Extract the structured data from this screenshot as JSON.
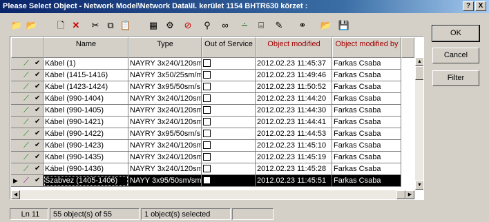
{
  "window": {
    "title": "Please Select Object - Network Model\\Network Data\\II. kerület 1154 BHTR630 körzet :",
    "help_label": "?",
    "close_label": "X"
  },
  "toolbar": {
    "tools": [
      "up-folder-icon",
      "folder-up-icon",
      "new-icon",
      "delete-icon",
      "cut-icon",
      "copy-icon",
      "paste-icon",
      "properties-icon",
      "tools-icon",
      "forbidden-icon",
      "search-settings-icon",
      "view-icon",
      "filter-icon",
      "tree-icon",
      "edit-icon",
      "binoculars-icon",
      "open-folder-icon",
      "save-icon"
    ]
  },
  "grid": {
    "columns": [
      "Name",
      "Type",
      "Out of Service",
      "Object modified",
      "Object modified by"
    ],
    "rows": [
      {
        "name": "Kábel (1)",
        "type": "NAYRY 3x240/120sm",
        "modified": "2012.02.23 11:45:37",
        "by": "Farkas Csaba"
      },
      {
        "name": "Kábel (1415-1416)",
        "type": "NAYRY 3x50/25sm/m",
        "modified": "2012.02.23 11:49:46",
        "by": "Farkas Csaba"
      },
      {
        "name": "Kábel (1423-1424)",
        "type": "NAYRY 3x95/50sm/s",
        "modified": "2012.02.23 11:50:52",
        "by": "Farkas Csaba"
      },
      {
        "name": "Kábel (990-1404)",
        "type": "NAYRY 3x240/120sm",
        "modified": "2012.02.23 11:44:20",
        "by": "Farkas Csaba"
      },
      {
        "name": "Kábel (990-1405)",
        "type": "NAYRY 3x240/120sm",
        "modified": "2012.02.23 11:44:30",
        "by": "Farkas Csaba"
      },
      {
        "name": "Kábel (990-1421)",
        "type": "NAYRY 3x240/120sm",
        "modified": "2012.02.23 11:44:41",
        "by": "Farkas Csaba"
      },
      {
        "name": "Kábel (990-1422)",
        "type": "NAYRY 3x95/50sm/s",
        "modified": "2012.02.23 11:44:53",
        "by": "Farkas Csaba"
      },
      {
        "name": "Kábel (990-1423)",
        "type": "NAYRY 3x240/120sm",
        "modified": "2012.02.23 11:45:10",
        "by": "Farkas Csaba"
      },
      {
        "name": "Kábel (990-1435)",
        "type": "NAYRY 3x240/120sm",
        "modified": "2012.02.23 11:45:19",
        "by": "Farkas Csaba"
      },
      {
        "name": "Kábel (990-1436)",
        "type": "NAYRY 3x240/120sm",
        "modified": "2012.02.23 11:45:28",
        "by": "Farkas Csaba"
      },
      {
        "name": "Szabvez (1405-1406)",
        "type": "NAYY 3x95/50sm/sm",
        "modified": "2012.02.23 11:45:51",
        "by": "Farkas Csaba"
      }
    ]
  },
  "buttons": {
    "ok": "OK",
    "cancel": "Cancel",
    "filter": "Filter"
  },
  "status": {
    "line": "Ln 11",
    "objects": "55 object(s) of 55",
    "selected": "1 object(s) selected"
  }
}
